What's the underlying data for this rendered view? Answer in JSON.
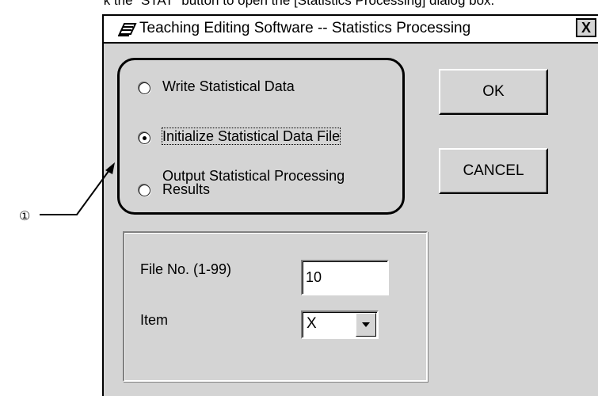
{
  "caption": "k the “STAT” button to open the [Statistics Processing] dialog box.",
  "dialog": {
    "title": "Teaching Editing Software -- Statistics Processing",
    "close_label": "X",
    "icon": "teaching-pendant-icon",
    "options": [
      {
        "label": "Write Statistical Data",
        "checked": false
      },
      {
        "label": "Initialize Statistical Data File",
        "checked": true
      },
      {
        "label_line1": "Output Statistical Processing",
        "label_line2": "Results",
        "checked": false
      }
    ],
    "ok_label": "OK",
    "cancel_label": "CANCEL",
    "file_no_label": "File No. (1-99)",
    "file_no_value": "10",
    "item_label": "Item",
    "item_value": "X"
  },
  "callout": {
    "number": "①"
  }
}
